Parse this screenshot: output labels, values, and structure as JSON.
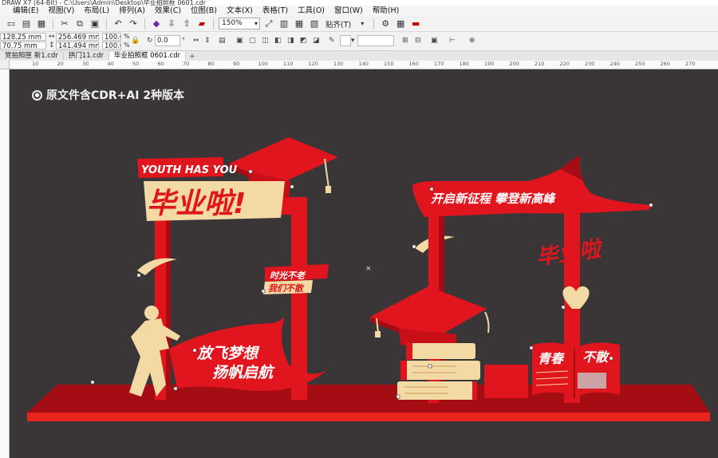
{
  "window": {
    "title": "DRAW X7 (64-Bit) - C:\\Users\\Admin\\Desktop\\毕业拍照框 0601.cdr"
  },
  "menu": [
    "编辑(E)",
    "视图(V)",
    "布局(L)",
    "排列(A)",
    "效果(C)",
    "位图(B)",
    "文本(X)",
    "表格(T)",
    "工具(O)",
    "窗口(W)",
    "帮助(H)"
  ],
  "toolbar": {
    "zoom": "150%",
    "snap_label": "贴齐(T)"
  },
  "properties": {
    "x": "128.25 mm",
    "y": "70.75 mm",
    "width": "256.469 mm",
    "height": "141.494 mm",
    "scale_x": "100.0",
    "scale_y": "100.0",
    "percent": "%",
    "angle": "0.0",
    "degree": "°"
  },
  "tabs": [
    "党拍照匣 新1.cdr",
    "拱门11.cdr",
    "毕业拍照框 0601.cdr"
  ],
  "ruler_ticks": [
    "10",
    "20",
    "30",
    "40",
    "50",
    "60",
    "70",
    "80",
    "90",
    "100",
    "110",
    "120",
    "130",
    "140",
    "150",
    "160",
    "170",
    "180",
    "190",
    "200",
    "210",
    "220",
    "230",
    "240",
    "250",
    "260",
    "270"
  ],
  "canvas": {
    "caption": "原文件含CDR+AI 2种版本",
    "left_frame": {
      "youth_label": "YOUTH HAS YOU",
      "headline": "毕业啦!",
      "time_line1": "时光不老",
      "time_line2": "我们不散",
      "banner_line1": "放飞梦想",
      "banner_line2": "扬帆启航"
    },
    "right_frame": {
      "arch_slogan": "开启新征程 攀登新高峰",
      "headline": "毕业啦",
      "book_left": "青春",
      "book_right": "不散"
    }
  },
  "colors": {
    "red": "#e0151d",
    "dark_red": "#a50d14",
    "cream": "#f3d9a4",
    "canvas_bg": "#3a3637"
  }
}
